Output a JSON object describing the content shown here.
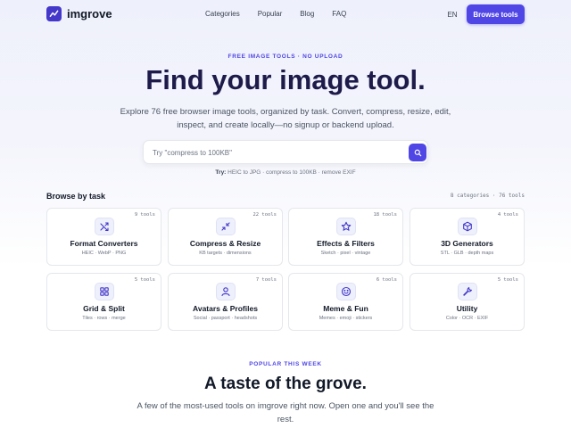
{
  "brand": {
    "name": "imgrove",
    "logo_icon": "sparkline-icon",
    "accent": "#4f46e5"
  },
  "nav": {
    "links": [
      "Categories",
      "Popular",
      "Blog",
      "FAQ"
    ],
    "lang": "EN",
    "cta": "Browse tools"
  },
  "hero": {
    "eyebrow": "FREE IMAGE TOOLS · NO UPLOAD",
    "title": "Find your image tool.",
    "subtitle": "Explore 76 free browser image tools, organized by task. Convert, compress, resize, edit, inspect, and create locally—no signup or backend upload.",
    "search_placeholder": "Try \"compress to 100KB\"",
    "search_icon": "search-icon",
    "try_label": "Try:",
    "try_examples": "HEIC to JPG · compress to 100KB · remove EXIF"
  },
  "browse": {
    "title": "Browse by task",
    "meta": "8 categories · 76 tools",
    "categories": [
      {
        "count": "9 tools",
        "title": "Format Converters",
        "sub": "HEIC · WebP · PNG",
        "icon": "shuffle-icon"
      },
      {
        "count": "22 tools",
        "title": "Compress & Resize",
        "sub": "KB targets · dimensions",
        "icon": "minimize-icon"
      },
      {
        "count": "18 tools",
        "title": "Effects & Filters",
        "sub": "Sketch · pixel · vintage",
        "icon": "star-icon"
      },
      {
        "count": "4 tools",
        "title": "3D Generators",
        "sub": "STL · GLB · depth maps",
        "icon": "cube-icon"
      },
      {
        "count": "5 tools",
        "title": "Grid & Split",
        "sub": "Tiles · rows · merge",
        "icon": "grid-icon"
      },
      {
        "count": "7 tools",
        "title": "Avatars & Profiles",
        "sub": "Social · passport · headshots",
        "icon": "user-icon"
      },
      {
        "count": "6 tools",
        "title": "Meme & Fun",
        "sub": "Memes · emoji · stickers",
        "icon": "smile-icon"
      },
      {
        "count": "5 tools",
        "title": "Utility",
        "sub": "Color · OCR · EXIF",
        "icon": "wrench-icon"
      }
    ]
  },
  "popular": {
    "eyebrow": "POPULAR THIS WEEK",
    "title": "A taste of the grove.",
    "subtitle": "A few of the most-used tools on imgrove right now. Open one and you'll see the rest."
  }
}
